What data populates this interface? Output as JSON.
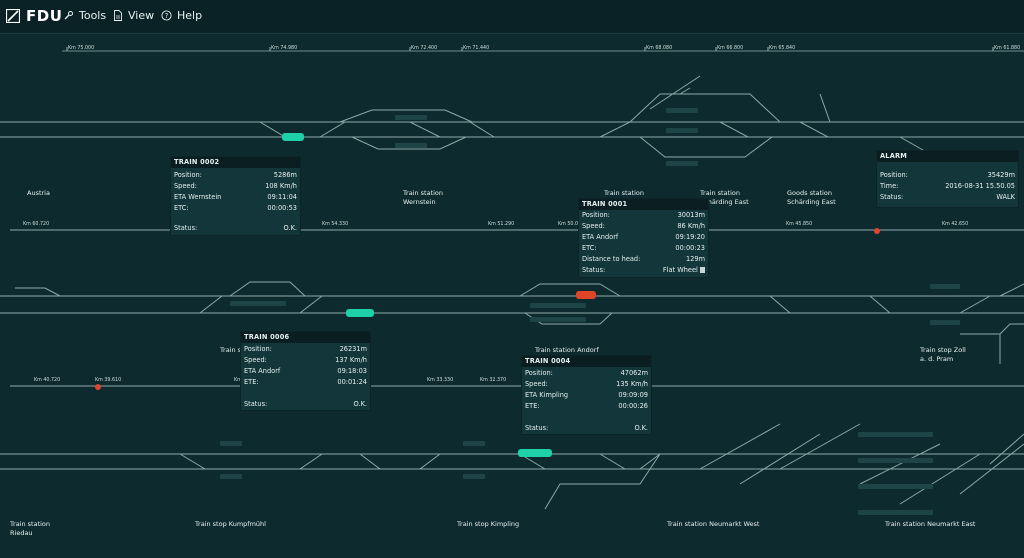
{
  "app": {
    "name": "FDU"
  },
  "menu": {
    "tools": "Tools",
    "view": "View",
    "help": "Help"
  },
  "colors": {
    "background": "#0d2b2e",
    "train": "#1fd1a8",
    "alarm": "#e0452a",
    "track": "#9db3b4"
  },
  "km_markers": {
    "row1": [
      "Km 75.000",
      "Km 74.980",
      "Km 72.400",
      "Km 71.440",
      "Km 68.080",
      "Km 66.800",
      "Km 65.840",
      "Km 61.880"
    ],
    "row2": [
      "Km 60.720",
      "Km 54.330",
      "Km 51.290",
      "Km 50.0",
      "Km 45.850",
      "Km 42.650"
    ],
    "row3": [
      "Km 40.720",
      "Km 39.610",
      "Km",
      "Km 33.330",
      "Km 32.370"
    ]
  },
  "stations": {
    "austria": "Austria",
    "wernstein": "Train station\nWernstein",
    "mid": "Train station",
    "schaerding_east": "Train station\nSchärding East",
    "goods_schaerding": "Goods station\nSchärding East",
    "stop_s": "Train st",
    "andorf": "Train station Andorf",
    "zoll": "Train stop Zoll\na. d. Pram",
    "riedau": "Train station\nRiedau",
    "kumpfmuehl": "Train stop Kumpfmühl",
    "kimpling": "Train stop Kimpling",
    "neumarkt_west": "Train station Neumarkt West",
    "neumarkt_east": "Train station Neumarkt East"
  },
  "trains": {
    "t0002": {
      "title": "TRAIN 0002",
      "rows": [
        [
          "Position:",
          "5286m"
        ],
        [
          "Speed:",
          "108 Km/h"
        ],
        [
          "ETA Wernstein",
          "09:11:04"
        ],
        [
          "ETC:",
          "00:00:53"
        ]
      ],
      "status_label": "Status:",
      "status": "O.K."
    },
    "t0001": {
      "title": "TRAIN 0001",
      "rows": [
        [
          "Position:",
          "30013m"
        ],
        [
          "Speed:",
          "86 Km/h"
        ],
        [
          "ETA Andorf",
          "09:19:20"
        ],
        [
          "ETC:",
          "00:00:23"
        ],
        [
          "Distance to head:",
          "129m"
        ]
      ],
      "status_label": "Status:",
      "status": "Flat Wheel"
    },
    "t0006": {
      "title": "TRAIN 0006",
      "rows": [
        [
          "Position:",
          "26231m"
        ],
        [
          "Speed:",
          "137 Km/h"
        ],
        [
          "ETA Andorf",
          "09:18:03"
        ],
        [
          "ETE:",
          "00:01:24"
        ]
      ],
      "status_label": "Status:",
      "status": "O.K."
    },
    "t0004": {
      "title": "TRAIN 0004",
      "rows": [
        [
          "Position:",
          "47062m"
        ],
        [
          "Speed:",
          "135 Km/h"
        ],
        [
          "ETA Kimpling",
          "09:09:09"
        ],
        [
          "ETE:",
          "00:00:26"
        ]
      ],
      "status_label": "Status:",
      "status": "O.K."
    }
  },
  "alarm": {
    "title": "ALARM",
    "rows": [
      [
        "Position:",
        "35429m"
      ],
      [
        "Time:",
        "2016-08-31 15.50.05"
      ],
      [
        "Status:",
        "WALK"
      ]
    ]
  }
}
